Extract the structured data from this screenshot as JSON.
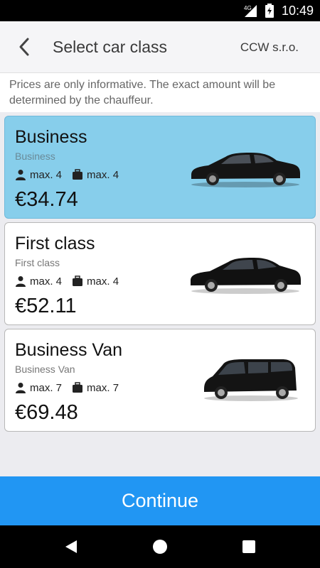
{
  "status_bar": {
    "time": "10:49",
    "network": "4G",
    "icons": [
      "signal-icon",
      "battery-icon"
    ]
  },
  "header": {
    "title": "Select car class",
    "company": "CCW s.r.o.",
    "back_icon": "chevron-left-icon"
  },
  "notice": "Prices are only informative. The exact amount will be determined by the chauffeur.",
  "cars": [
    {
      "name": "Business",
      "subtitle": "Business",
      "passengers": "max. 4",
      "luggage": "max. 4",
      "price": "€34.74",
      "selected": true
    },
    {
      "name": "First class",
      "subtitle": "First class",
      "passengers": "max. 4",
      "luggage": "max. 4",
      "price": "€52.11",
      "selected": false
    },
    {
      "name": "Business Van",
      "subtitle": "Business Van",
      "passengers": "max. 7",
      "luggage": "max. 7",
      "price": "€69.48",
      "selected": false
    }
  ],
  "continue_label": "Continue",
  "colors": {
    "accent": "#2196f3",
    "selected_card": "#87ceeb"
  },
  "nav_icons": [
    "back-triangle-icon",
    "home-circle-icon",
    "recents-square-icon"
  ]
}
